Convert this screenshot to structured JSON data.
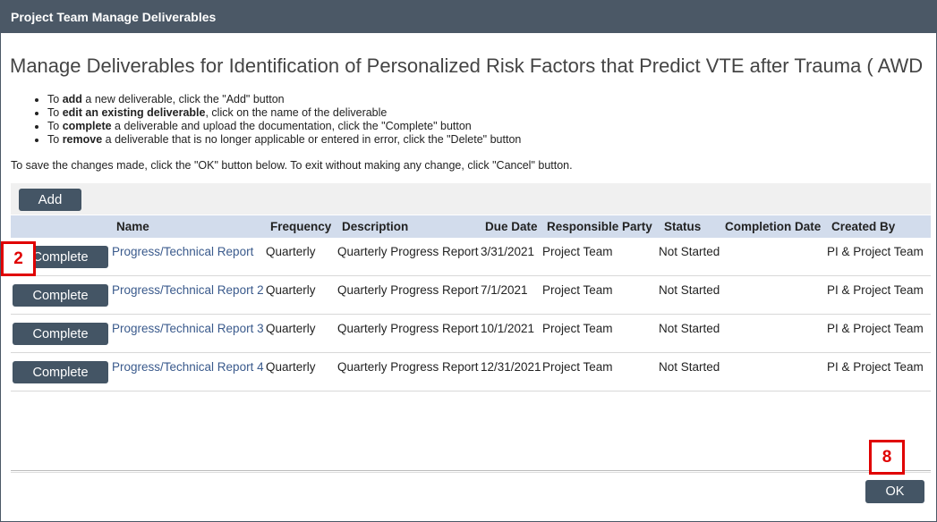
{
  "window": {
    "title": "Project Team Manage Deliverables"
  },
  "heading": "Manage Deliverables for Identification of Personalized Risk Factors that Predict VTE after Trauma ( AWD",
  "instructions": [
    {
      "prefix": "To ",
      "bold": "add",
      "suffix": " a new deliverable, click the \"Add\" button"
    },
    {
      "prefix": "To ",
      "bold": "edit an existing deliverable",
      "suffix": ", click on the name of the deliverable"
    },
    {
      "prefix": "To ",
      "bold": "complete",
      "suffix": " a deliverable and upload the documentation, click the \"Complete\" button"
    },
    {
      "prefix": "To ",
      "bold": "remove",
      "suffix": " a deliverable that is no longer applicable or entered in error, click the \"Delete\" button"
    }
  ],
  "save_note": "To save the changes made, click the \"OK\" button below.  To exit without making any change, click \"Cancel\" button.",
  "toolbar": {
    "add_label": "Add"
  },
  "table": {
    "headers": {
      "name": "Name",
      "frequency": "Frequency",
      "description": "Description",
      "due_date": "Due Date",
      "responsible_party": "Responsible Party",
      "status": "Status",
      "completion_date": "Completion Date",
      "created_by": "Created By"
    },
    "action_label": "Complete",
    "rows": [
      {
        "name": "Progress/Technical Report",
        "frequency": "Quarterly",
        "description": "Quarterly Progress Report",
        "due_date": "3/31/2021",
        "responsible_party": "Project Team",
        "status": "Not Started",
        "completion_date": "",
        "created_by": "PI & Project Team"
      },
      {
        "name": "Progress/Technical Report 2",
        "frequency": "Quarterly",
        "description": "Quarterly Progress Report",
        "due_date": "7/1/2021",
        "responsible_party": "Project Team",
        "status": "Not Started",
        "completion_date": "",
        "created_by": "PI & Project Team"
      },
      {
        "name": "Progress/Technical Report 3",
        "frequency": "Quarterly",
        "description": "Quarterly Progress Report",
        "due_date": "10/1/2021",
        "responsible_party": "Project Team",
        "status": "Not Started",
        "completion_date": "",
        "created_by": "PI & Project Team"
      },
      {
        "name": "Progress/Technical Report 4",
        "frequency": "Quarterly",
        "description": "Quarterly Progress Report",
        "due_date": "12/31/2021",
        "responsible_party": "Project Team",
        "status": "Not Started",
        "completion_date": "",
        "created_by": "PI & Project Team"
      }
    ]
  },
  "markers": {
    "complete_step": "2",
    "ok_step": "8"
  },
  "footer": {
    "ok_label": "OK"
  }
}
